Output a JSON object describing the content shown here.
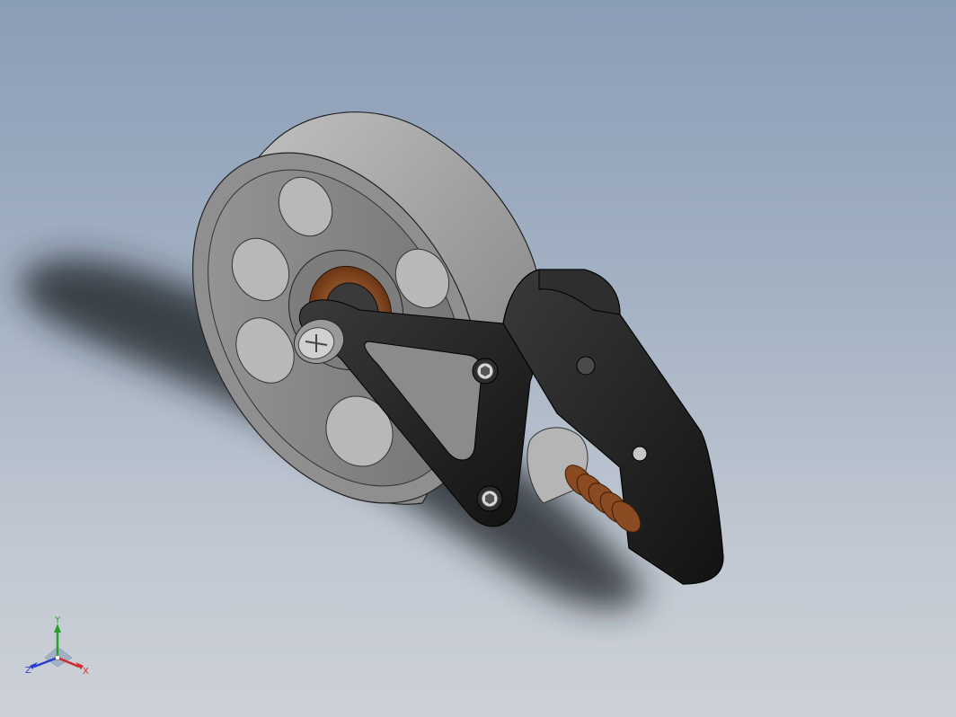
{
  "view": {
    "background_top": "#8a9db6",
    "background_bottom": "#cdd1d7",
    "model": "wheel-tensioner-assembly"
  },
  "colors": {
    "wheel_body": "#a8a8a8",
    "wheel_dark": "#6f6f6f",
    "bracket": "#1c1c1c",
    "bearing": "#8a4a22",
    "spring": "#7a3d16",
    "shadow": "#1f2228"
  },
  "triad": {
    "x_label": "X",
    "y_label": "Y",
    "z_label": "Z",
    "x_color": "#d22a2a",
    "y_color": "#2aa02a",
    "z_color": "#2a3ad2"
  }
}
